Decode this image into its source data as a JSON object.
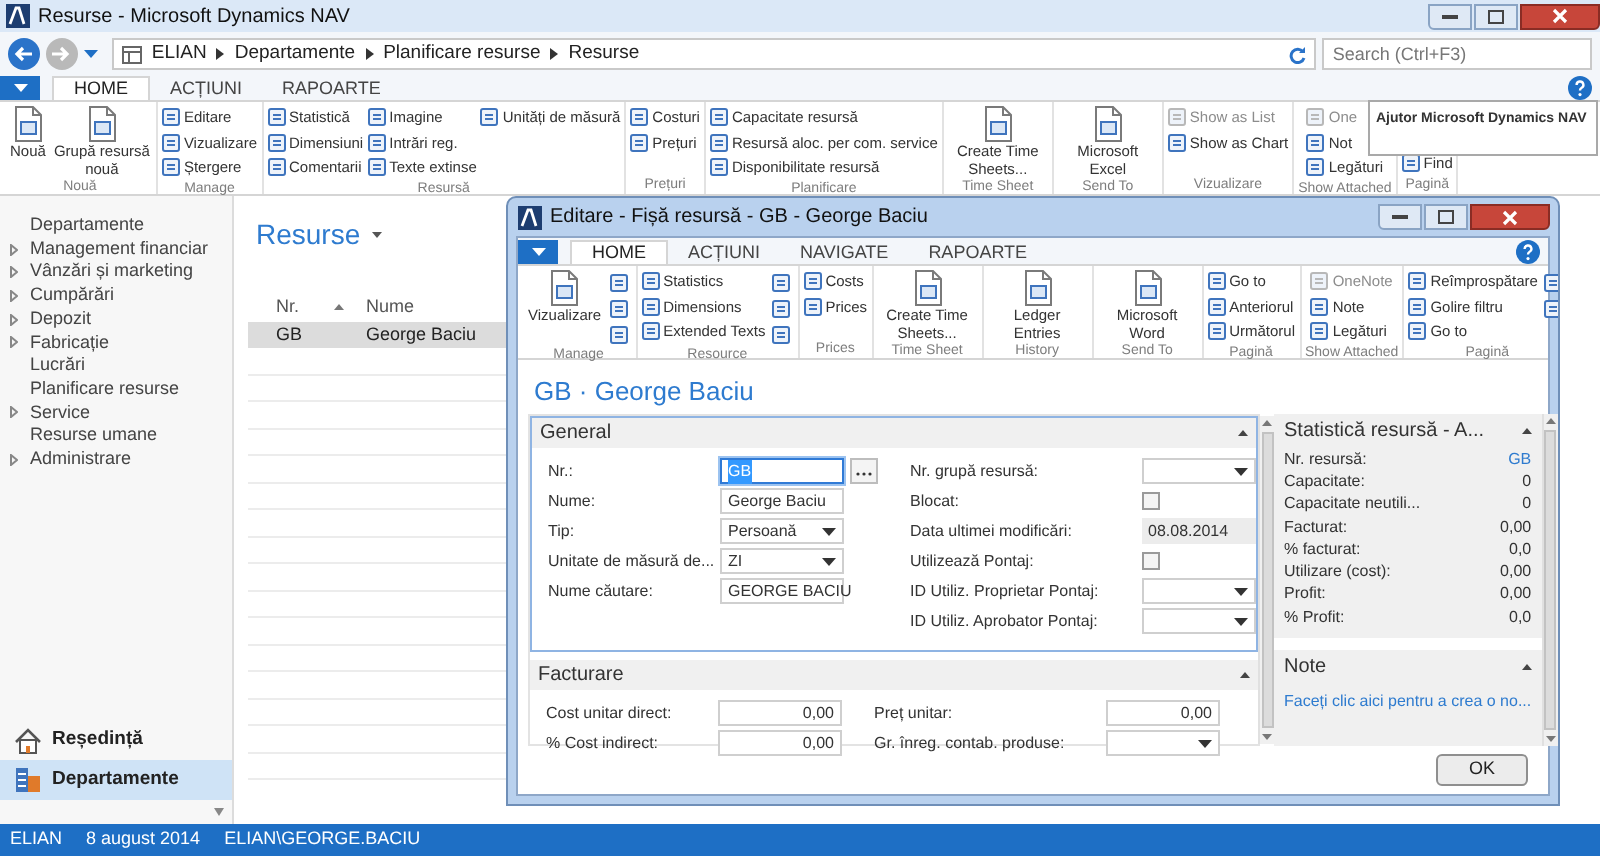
{
  "window": {
    "title": "Resurse - Microsoft Dynamics NAV"
  },
  "address_bar": {
    "breadcrumbs": [
      "ELIAN",
      "Departamente",
      "Planificare resurse",
      "Resurse"
    ]
  },
  "search": {
    "placeholder": "Search (Ctrl+F3)"
  },
  "ribbon_tabs": [
    {
      "label": "HOME",
      "selected": true
    },
    {
      "label": "ACȚIUNI",
      "selected": false
    },
    {
      "label": "RAPOARTE",
      "selected": false
    }
  ],
  "ribbon_groups": [
    {
      "label": "Nouă",
      "items": [
        {
          "kind": "large",
          "label": "Nouă"
        },
        {
          "kind": "large",
          "label": "Grupă resursă nouă"
        }
      ]
    },
    {
      "label": "Manage",
      "items": [
        {
          "kind": "small",
          "label": "Editare"
        },
        {
          "kind": "small",
          "label": "Vizualizare"
        },
        {
          "kind": "small",
          "label": "Ștergere"
        }
      ]
    },
    {
      "label": "Resursă",
      "items": [
        {
          "kind": "small",
          "label": "Statistică"
        },
        {
          "kind": "small",
          "label": "Dimensiuni"
        },
        {
          "kind": "small",
          "label": "Comentarii"
        },
        {
          "kind": "small",
          "label": "Imagine"
        },
        {
          "kind": "small",
          "label": "Intrări reg."
        },
        {
          "kind": "small",
          "label": "Texte extinse"
        },
        {
          "kind": "small",
          "label": "Unități de măsură"
        }
      ]
    },
    {
      "label": "Prețuri",
      "items": [
        {
          "kind": "small",
          "label": "Costuri"
        },
        {
          "kind": "small",
          "label": "Prețuri"
        }
      ]
    },
    {
      "label": "Planificare",
      "items": [
        {
          "kind": "small",
          "label": "Capacitate resursă"
        },
        {
          "kind": "small",
          "label": "Resursă aloc. per com. service"
        },
        {
          "kind": "small",
          "label": "Disponibilitate resursă"
        }
      ]
    },
    {
      "label": "Time Sheet",
      "items": [
        {
          "kind": "large",
          "label": "Create Time Sheets..."
        }
      ]
    },
    {
      "label": "Send To",
      "items": [
        {
          "kind": "large",
          "label": "Microsoft Excel"
        }
      ]
    },
    {
      "label": "Vizualizare",
      "items": [
        {
          "kind": "small",
          "label": "Show as List",
          "disabled": true
        },
        {
          "kind": "small",
          "label": "Show as Chart",
          "disabled": false
        }
      ]
    },
    {
      "label": "Show Attached",
      "items": [
        {
          "kind": "small",
          "label": "One",
          "disabled": true
        },
        {
          "kind": "small",
          "label": "Not",
          "disabled": false
        },
        {
          "kind": "small",
          "label": "Legături",
          "disabled": false
        }
      ]
    },
    {
      "label": "Pagină",
      "items": [
        {
          "kind": "small",
          "label": "Find"
        }
      ]
    }
  ],
  "tooltip": {
    "text": "Ajutor Microsoft Dynamics NAV"
  },
  "sidebar": {
    "items": [
      {
        "label": "Departamente",
        "kind": "page"
      },
      {
        "label": "Management financiar",
        "kind": "folder"
      },
      {
        "label": "Vânzări și marketing",
        "kind": "folder"
      },
      {
        "label": "Cumpărări",
        "kind": "folder"
      },
      {
        "label": "Depozit",
        "kind": "folder"
      },
      {
        "label": "Fabricație",
        "kind": "folder"
      },
      {
        "label": "Lucrări",
        "kind": "page"
      },
      {
        "label": "Planificare resurse",
        "kind": "page"
      },
      {
        "label": "Service",
        "kind": "folder"
      },
      {
        "label": "Resurse umane",
        "kind": "page"
      },
      {
        "label": "Administrare",
        "kind": "folder"
      }
    ],
    "buttons": [
      {
        "label": "Reședință",
        "selected": false
      },
      {
        "label": "Departamente",
        "selected": true
      }
    ]
  },
  "list": {
    "title": "Resurse",
    "columns": [
      {
        "label": "Nr.",
        "sorted": true
      },
      {
        "label": "Nume",
        "sorted": false
      }
    ],
    "rows": [
      {
        "cells": [
          "GB",
          "George Baciu"
        ],
        "selected": true
      }
    ]
  },
  "status_bar": [
    "ELIAN",
    "8 august 2014",
    "ELIAN\\GEORGE.BACIU"
  ],
  "dialog": {
    "title": "Editare - Fișă resursă - GB - George Baciu",
    "tabs": [
      {
        "label": "HOME",
        "selected": true
      },
      {
        "label": "ACȚIUNI",
        "selected": false
      },
      {
        "label": "NAVIGATE",
        "selected": false
      },
      {
        "label": "RAPOARTE",
        "selected": false
      }
    ],
    "ribbon_groups": [
      {
        "label": "Manage",
        "items": [
          {
            "kind": "large",
            "label": "Vizualizare"
          },
          {
            "kind": "icon"
          },
          {
            "kind": "icon"
          },
          {
            "kind": "icon"
          }
        ]
      },
      {
        "label": "Resource",
        "items": [
          {
            "kind": "small",
            "label": "Statistics"
          },
          {
            "kind": "small",
            "label": "Dimensions"
          },
          {
            "kind": "small",
            "label": "Extended Texts"
          },
          {
            "kind": "icon"
          },
          {
            "kind": "icon"
          },
          {
            "kind": "icon"
          }
        ]
      },
      {
        "label": "Prices",
        "items": [
          {
            "kind": "small",
            "label": "Costs"
          },
          {
            "kind": "small",
            "label": "Prices"
          }
        ]
      },
      {
        "label": "Time Sheet",
        "items": [
          {
            "kind": "large",
            "label": "Create Time Sheets..."
          }
        ]
      },
      {
        "label": "History",
        "items": [
          {
            "kind": "large",
            "label": "Ledger Entries"
          }
        ]
      },
      {
        "label": "Send To",
        "items": [
          {
            "kind": "large",
            "label": "Microsoft Word"
          }
        ]
      },
      {
        "label": "Pagină",
        "items": [
          {
            "kind": "small",
            "label": "Go to"
          },
          {
            "kind": "small",
            "label": "Anteriorul"
          },
          {
            "kind": "small",
            "label": "Următorul"
          }
        ]
      },
      {
        "label": "Show Attached",
        "items": [
          {
            "kind": "small",
            "label": "OneNote",
            "disabled": true
          },
          {
            "kind": "small",
            "label": "Note",
            "disabled": false
          },
          {
            "kind": "small",
            "label": "Legături",
            "disabled": false
          }
        ]
      },
      {
        "label": "Pagină",
        "items": [
          {
            "kind": "small",
            "label": "Reîmprospătare"
          },
          {
            "kind": "small",
            "label": "Golire filtru"
          },
          {
            "kind": "small",
            "label": "Go to"
          },
          {
            "kind": "icon"
          },
          {
            "kind": "icon"
          }
        ]
      }
    ],
    "heading": "GB · George Baciu",
    "fasttabs": [
      {
        "title": "General",
        "expanded": true,
        "left_fields": [
          {
            "label": "Nr.:",
            "kind": "lookup",
            "value": "GB",
            "focused": true
          },
          {
            "label": "Nume:",
            "kind": "text",
            "value": "George Baciu",
            "focused": false
          },
          {
            "label": "Tip:",
            "kind": "dropdown",
            "value": "Persoană",
            "focused": false
          },
          {
            "label": "Unitate de măsură de...",
            "kind": "dropdown",
            "value": "ZI",
            "focused": false
          },
          {
            "label": "Nume căutare:",
            "kind": "text",
            "value": "GEORGE BACIU",
            "focused": false
          }
        ],
        "right_fields": [
          {
            "label": "Nr. grupă resursă:",
            "kind": "dropdown"
          },
          {
            "label": "Blocat:",
            "kind": "checkbox",
            "checked": false
          },
          {
            "label": "Data ultimei modificări:",
            "kind": "readonly",
            "value": "08.08.2014"
          },
          {
            "label": "Utilizează Pontaj:",
            "kind": "checkbox",
            "checked": false
          },
          {
            "label": "ID Utiliz. Proprietar Pontaj:",
            "kind": "dropdown"
          },
          {
            "label": "ID Utiliz. Aprobator Pontaj:",
            "kind": "dropdown"
          }
        ]
      },
      {
        "title": "Facturare",
        "expanded": true,
        "left_fields": [
          {
            "label": "Cost unitar direct:",
            "kind": "number",
            "value": "0,00",
            "focused": false
          },
          {
            "label": "% Cost indirect:",
            "kind": "number",
            "value": "0,00",
            "focused": false
          }
        ],
        "right_fields": [
          {
            "label": "Preț unitar:",
            "kind": "number",
            "value": "0,00"
          },
          {
            "label": "Gr. înreg. contab. produse:",
            "kind": "dropdown"
          }
        ]
      }
    ],
    "factboxes": [
      {
        "title": "Statistică resursă - A...",
        "expanded": true,
        "rows": [
          {
            "label": "Nr. resursă:",
            "value": "GB",
            "kind": "link"
          },
          {
            "label": "Capacitate:",
            "value": "0",
            "kind": "text"
          },
          {
            "label": "Capacitate neutili...",
            "value": "0",
            "kind": "text"
          },
          {
            "label": "Facturat:",
            "value": "0,00",
            "kind": "text"
          },
          {
            "label": "% facturat:",
            "value": "0,0",
            "kind": "text"
          },
          {
            "label": "Utilizare (cost):",
            "value": "0,00",
            "kind": "text"
          },
          {
            "label": "Profit:",
            "value": "0,00",
            "kind": "text"
          },
          {
            "label": "% Profit:",
            "value": "0,0",
            "kind": "text"
          }
        ]
      },
      {
        "title": "Note",
        "expanded": true,
        "link": "Faceți clic aici pentru a crea o no..."
      }
    ],
    "ok_button": "OK"
  }
}
